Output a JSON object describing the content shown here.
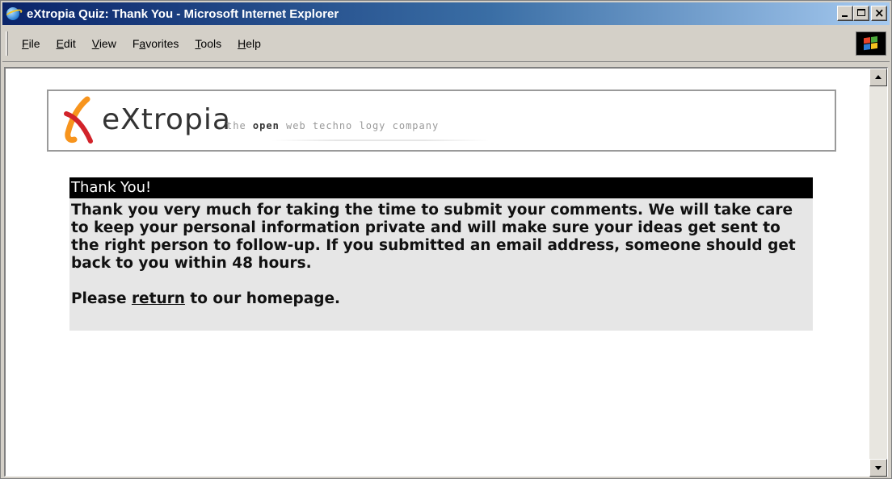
{
  "window": {
    "title": "eXtropia Quiz: Thank You - Microsoft Internet Explorer"
  },
  "menu": {
    "items": [
      {
        "accel": "F",
        "rest": "ile"
      },
      {
        "accel": "E",
        "rest": "dit"
      },
      {
        "accel": "V",
        "rest": "iew"
      },
      {
        "pre": "F",
        "accel": "a",
        "rest": "vorites"
      },
      {
        "accel": "T",
        "rest": "ools"
      },
      {
        "accel": "H",
        "rest": "elp"
      }
    ]
  },
  "banner": {
    "logo_text": "eXtropia",
    "tagline_pre": "the ",
    "tagline_bold": "open",
    "tagline_post": " web techno logy company"
  },
  "message": {
    "header": "Thank You!",
    "body": "Thank you very much for taking the time to submit your comments. We will take care to keep your personal information private and will make sure your ideas get sent to the right person to follow-up. If you submitted an email address, someone should get back to you within 48 hours.",
    "return_pre": "Please ",
    "return_link": "return",
    "return_post": " to our homepage."
  },
  "colors": {
    "titlebar_start": "#0a246a",
    "titlebar_end": "#a6caf0",
    "chrome": "#d4d0c8",
    "header_bg": "#000000",
    "body_bg": "#e6e6e6",
    "logo_orange": "#f7941d",
    "logo_red": "#d2232a"
  }
}
